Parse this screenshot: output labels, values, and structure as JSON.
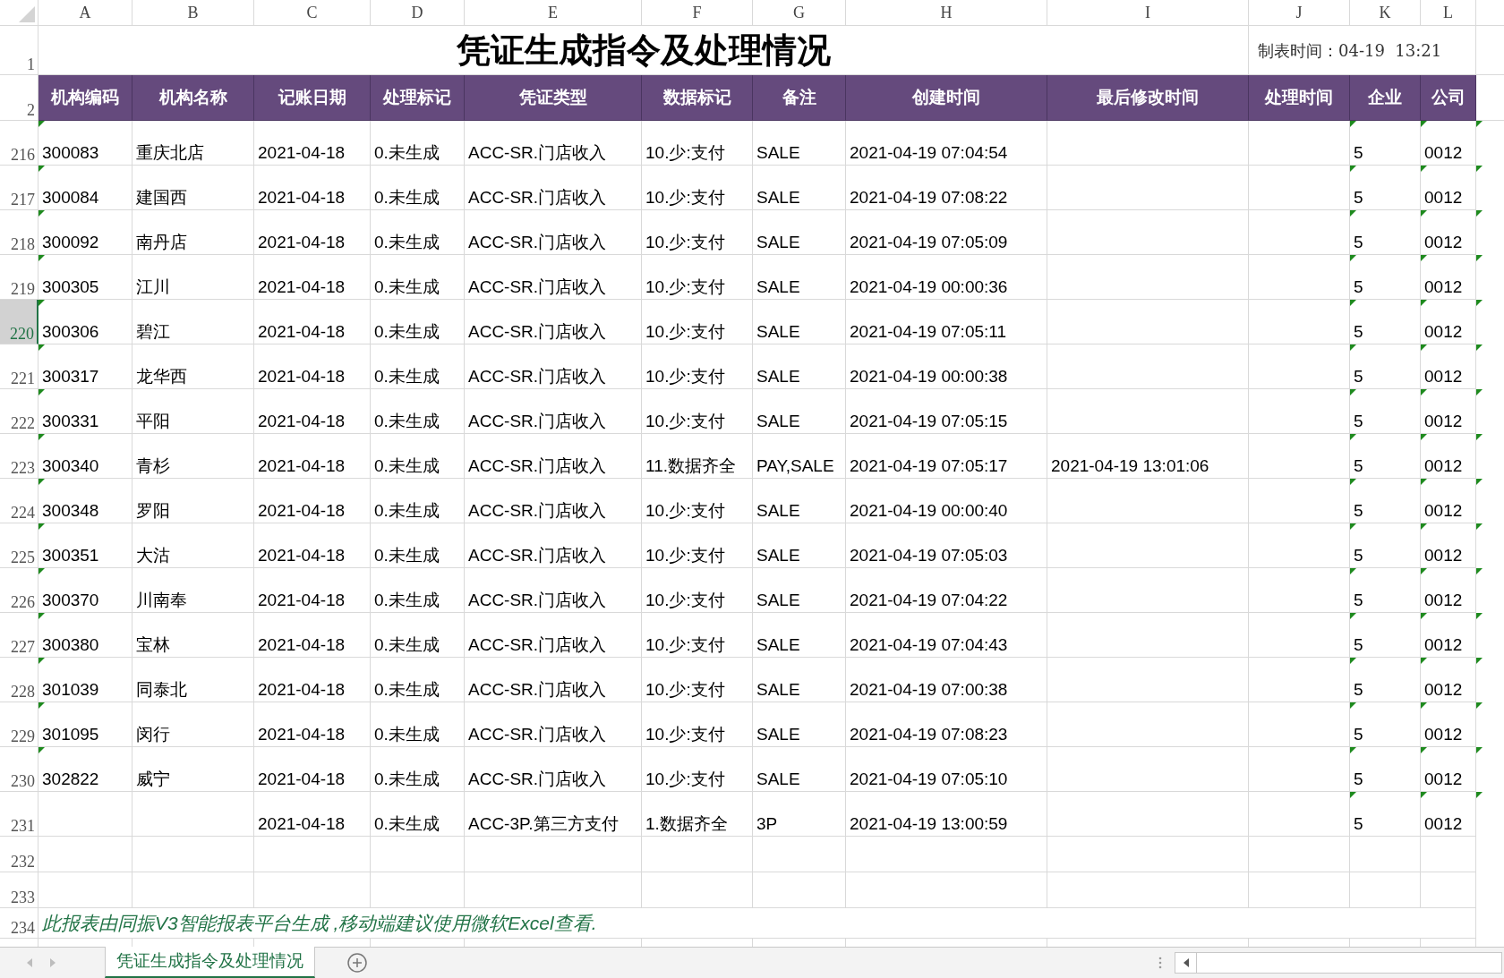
{
  "column_headers": [
    {
      "label": "A"
    },
    {
      "label": "B"
    },
    {
      "label": "C"
    },
    {
      "label": "D"
    },
    {
      "label": "E"
    },
    {
      "label": "F"
    },
    {
      "label": "G"
    },
    {
      "label": "H"
    },
    {
      "label": "I"
    },
    {
      "label": "J"
    },
    {
      "label": "K"
    },
    {
      "label": "L"
    }
  ],
  "title_row": {
    "row_number": "1",
    "title": "凭证生成指令及处理情况",
    "timestamp": "制表时间：04-19  13:21"
  },
  "header_row": {
    "row_number": "2",
    "labels": [
      "机构编码",
      "机构名称",
      "记账日期",
      "处理标记",
      "凭证类型",
      "数据标记",
      "备注",
      "创建时间",
      "最后修改时间",
      "处理时间",
      "企业",
      "公司"
    ]
  },
  "rows": [
    {
      "row_number": "216",
      "selected": false,
      "code_warning": true,
      "number_warning": true,
      "code": "300083",
      "name": "重庆北店",
      "date": "2021-04-18",
      "status": "0.未生成",
      "voucher_type": "ACC-SR.门店收入",
      "data_flag": "10.少:支付",
      "remark": "SALE",
      "created": "2021-04-19 07:04:54",
      "enterprise": "5",
      "company": "0012"
    },
    {
      "row_number": "217",
      "selected": false,
      "code_warning": true,
      "number_warning": true,
      "code": "300084",
      "name": "建国西",
      "date": "2021-04-18",
      "status": "0.未生成",
      "voucher_type": "ACC-SR.门店收入",
      "data_flag": "10.少:支付",
      "remark": "SALE",
      "created": "2021-04-19 07:08:22",
      "enterprise": "5",
      "company": "0012"
    },
    {
      "row_number": "218",
      "selected": false,
      "code_warning": true,
      "number_warning": true,
      "code": "300092",
      "name": "南丹店",
      "date": "2021-04-18",
      "status": "0.未生成",
      "voucher_type": "ACC-SR.门店收入",
      "data_flag": "10.少:支付",
      "remark": "SALE",
      "created": "2021-04-19 07:05:09",
      "enterprise": "5",
      "company": "0012"
    },
    {
      "row_number": "219",
      "selected": false,
      "code_warning": true,
      "number_warning": true,
      "code": "300305",
      "name": "江川",
      "date": "2021-04-18",
      "status": "0.未生成",
      "voucher_type": "ACC-SR.门店收入",
      "data_flag": "10.少:支付",
      "remark": "SALE",
      "created": "2021-04-19 00:00:36",
      "enterprise": "5",
      "company": "0012"
    },
    {
      "row_number": "220",
      "selected": true,
      "code_warning": true,
      "number_warning": true,
      "code": "300306",
      "name": "碧江",
      "date": "2021-04-18",
      "status": "0.未生成",
      "voucher_type": "ACC-SR.门店收入",
      "data_flag": "10.少:支付",
      "remark": "SALE",
      "created": "2021-04-19 07:05:11",
      "enterprise": "5",
      "company": "0012"
    },
    {
      "row_number": "221",
      "selected": false,
      "code_warning": true,
      "number_warning": true,
      "code": "300317",
      "name": "龙华西",
      "date": "2021-04-18",
      "status": "0.未生成",
      "voucher_type": "ACC-SR.门店收入",
      "data_flag": "10.少:支付",
      "remark": "SALE",
      "created": "2021-04-19 00:00:38",
      "enterprise": "5",
      "company": "0012"
    },
    {
      "row_number": "222",
      "selected": false,
      "code_warning": true,
      "number_warning": true,
      "code": "300331",
      "name": "平阳",
      "date": "2021-04-18",
      "status": "0.未生成",
      "voucher_type": "ACC-SR.门店收入",
      "data_flag": "10.少:支付",
      "remark": "SALE",
      "created": "2021-04-19 07:05:15",
      "enterprise": "5",
      "company": "0012"
    },
    {
      "row_number": "223",
      "selected": false,
      "code_warning": true,
      "number_warning": true,
      "code": "300340",
      "name": "青杉",
      "date": "2021-04-18",
      "status": "0.未生成",
      "voucher_type": "ACC-SR.门店收入",
      "data_flag": "11.数据齐全",
      "remark": "PAY,SALE",
      "created": "2021-04-19 07:05:17",
      "modified": "2021-04-19 13:01:06",
      "enterprise": "5",
      "company": "0012"
    },
    {
      "row_number": "224",
      "selected": false,
      "code_warning": true,
      "number_warning": true,
      "code": "300348",
      "name": "罗阳",
      "date": "2021-04-18",
      "status": "0.未生成",
      "voucher_type": "ACC-SR.门店收入",
      "data_flag": "10.少:支付",
      "remark": "SALE",
      "created": "2021-04-19 00:00:40",
      "enterprise": "5",
      "company": "0012"
    },
    {
      "row_number": "225",
      "selected": false,
      "code_warning": true,
      "number_warning": true,
      "code": "300351",
      "name": "大沽",
      "date": "2021-04-18",
      "status": "0.未生成",
      "voucher_type": "ACC-SR.门店收入",
      "data_flag": "10.少:支付",
      "remark": "SALE",
      "created": "2021-04-19 07:05:03",
      "enterprise": "5",
      "company": "0012"
    },
    {
      "row_number": "226",
      "selected": false,
      "code_warning": true,
      "number_warning": true,
      "code": "300370",
      "name": "川南奉",
      "date": "2021-04-18",
      "status": "0.未生成",
      "voucher_type": "ACC-SR.门店收入",
      "data_flag": "10.少:支付",
      "remark": "SALE",
      "created": "2021-04-19 07:04:22",
      "enterprise": "5",
      "company": "0012"
    },
    {
      "row_number": "227",
      "selected": false,
      "code_warning": true,
      "number_warning": true,
      "code": "300380",
      "name": "宝林",
      "date": "2021-04-18",
      "status": "0.未生成",
      "voucher_type": "ACC-SR.门店收入",
      "data_flag": "10.少:支付",
      "remark": "SALE",
      "created": "2021-04-19 07:04:43",
      "enterprise": "5",
      "company": "0012"
    },
    {
      "row_number": "228",
      "selected": false,
      "code_warning": true,
      "number_warning": true,
      "code": "301039",
      "name": "同泰北",
      "date": "2021-04-18",
      "status": "0.未生成",
      "voucher_type": "ACC-SR.门店收入",
      "data_flag": "10.少:支付",
      "remark": "SALE",
      "created": "2021-04-19 07:00:38",
      "enterprise": "5",
      "company": "0012"
    },
    {
      "row_number": "229",
      "selected": false,
      "code_warning": true,
      "number_warning": true,
      "code": "301095",
      "name": "闵行",
      "date": "2021-04-18",
      "status": "0.未生成",
      "voucher_type": "ACC-SR.门店收入",
      "data_flag": "10.少:支付",
      "remark": "SALE",
      "created": "2021-04-19 07:08:23",
      "enterprise": "5",
      "company": "0012"
    },
    {
      "row_number": "230",
      "selected": false,
      "code_warning": true,
      "number_warning": true,
      "code": "302822",
      "name": "威宁",
      "date": "2021-04-18",
      "status": "0.未生成",
      "voucher_type": "ACC-SR.门店收入",
      "data_flag": "10.少:支付",
      "remark": "SALE",
      "created": "2021-04-19 07:05:10",
      "enterprise": "5",
      "company": "0012"
    },
    {
      "row_number": "231",
      "selected": false,
      "code_warning": false,
      "number_warning": true,
      "date": "2021-04-18",
      "status": "0.未生成",
      "voucher_type": "ACC-3P.第三方支付",
      "data_flag": "1.数据齐全",
      "remark": "3P",
      "created": "2021-04-19 13:00:59",
      "enterprise": "5",
      "company": "0012"
    }
  ],
  "empty_rows": [
    {
      "row_number": "232"
    },
    {
      "row_number": "233"
    }
  ],
  "footer_row": {
    "row_number": "234",
    "note": "此报表由同振V3智能报表平台生成 ,移动端建议使用微软Excel查看."
  },
  "sheet_tabs": [
    {
      "label": "凭证生成指令及处理情况",
      "selected": true
    }
  ]
}
